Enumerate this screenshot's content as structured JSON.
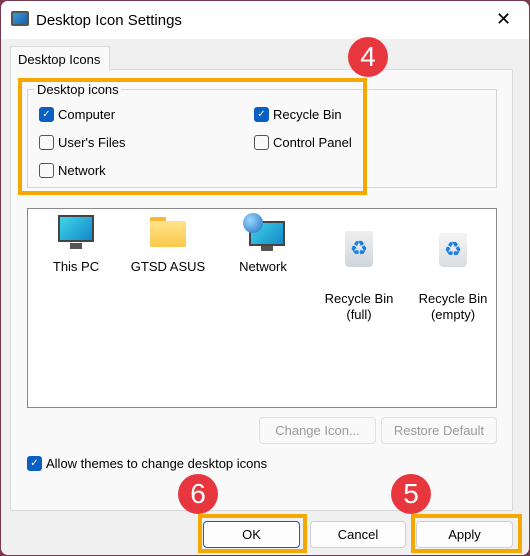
{
  "window": {
    "title": "Desktop Icon Settings",
    "close": "✕"
  },
  "tabs": [
    {
      "label": "Desktop Icons",
      "active": true
    }
  ],
  "group": {
    "label": "Desktop icons",
    "items": [
      {
        "label": "Computer",
        "checked": true
      },
      {
        "label": "Recycle Bin",
        "checked": true
      },
      {
        "label": "User's Files",
        "checked": false
      },
      {
        "label": "Control Panel",
        "checked": false
      },
      {
        "label": "Network",
        "checked": false
      }
    ]
  },
  "icons": [
    {
      "label": "This PC",
      "icon": "monitor-icon"
    },
    {
      "label": "GTSD ASUS",
      "icon": "folder-icon"
    },
    {
      "label": "Network",
      "icon": "network-globe-icon"
    },
    {
      "label": "Recycle Bin\n(full)",
      "icon": "recycle-bin-full-icon"
    },
    {
      "label": "Recycle Bin\n(empty)",
      "icon": "recycle-bin-empty-icon"
    }
  ],
  "buttons": {
    "change_icon": "Change Icon...",
    "restore_default": "Restore Default",
    "ok": "OK",
    "cancel": "Cancel",
    "apply": "Apply"
  },
  "allow_themes": {
    "label": "Allow themes to change desktop icons",
    "checked": true
  },
  "annotations": {
    "b4": "4",
    "b5": "5",
    "b6": "6"
  },
  "colors": {
    "highlight": "#f5a800",
    "badge": "#e8363f",
    "checkbox": "#0a5fc2"
  }
}
